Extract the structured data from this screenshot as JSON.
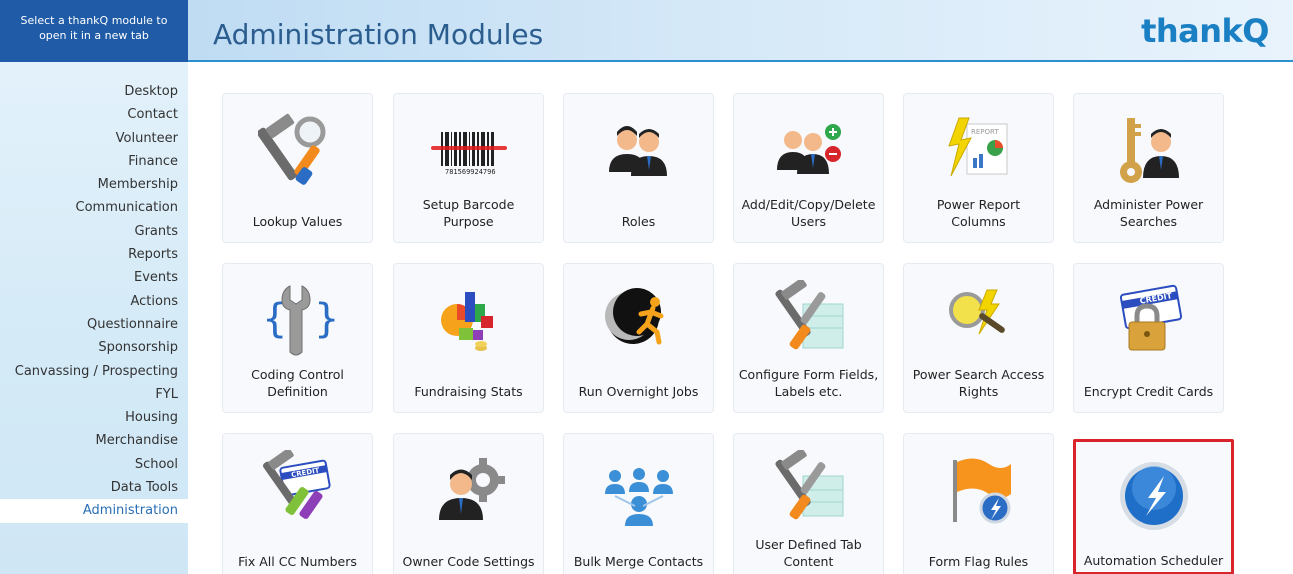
{
  "sidebar": {
    "header": "Select a thankQ module to open it in a new tab",
    "items": [
      {
        "label": "Desktop"
      },
      {
        "label": "Contact"
      },
      {
        "label": "Volunteer"
      },
      {
        "label": "Finance"
      },
      {
        "label": "Membership"
      },
      {
        "label": "Communication"
      },
      {
        "label": "Grants"
      },
      {
        "label": "Reports"
      },
      {
        "label": "Events"
      },
      {
        "label": "Actions"
      },
      {
        "label": "Questionnaire"
      },
      {
        "label": "Sponsorship"
      },
      {
        "label": "Canvassing / Prospecting"
      },
      {
        "label": "FYL"
      },
      {
        "label": "Housing"
      },
      {
        "label": "Merchandise"
      },
      {
        "label": "School"
      },
      {
        "label": "Data Tools"
      },
      {
        "label": "Administration",
        "active": true
      }
    ]
  },
  "header": {
    "title": "Administration Modules",
    "logo": "thankQ"
  },
  "modules": [
    {
      "label": "Lookup Values",
      "icon": "hammer-screwdriver-magnifier-icon"
    },
    {
      "label": "Setup Barcode Purpose",
      "icon": "barcode-icon",
      "barcode_text": "781569924796"
    },
    {
      "label": "Roles",
      "icon": "people-icon"
    },
    {
      "label": "Add/Edit/Copy/Delete Users",
      "icon": "users-add-remove-icon"
    },
    {
      "label": "Power Report Columns",
      "icon": "power-report-icon",
      "report_text": "REPORT"
    },
    {
      "label": "Administer Power Searches",
      "icon": "key-user-icon"
    },
    {
      "label": "Coding Control Definition",
      "icon": "wrench-braces-icon"
    },
    {
      "label": "Fundraising Stats",
      "icon": "chart-cubes-icon"
    },
    {
      "label": "Run Overnight Jobs",
      "icon": "moon-runner-icon"
    },
    {
      "label": "Configure Form Fields, Labels etc.",
      "icon": "tools-form-icon"
    },
    {
      "label": "Power Search Access Rights",
      "icon": "search-key-icon"
    },
    {
      "label": "Encrypt Credit Cards",
      "icon": "credit-card-lock-icon",
      "card_text": "CREDIT"
    },
    {
      "label": "Fix All CC Numbers",
      "icon": "credit-card-tools-icon",
      "card_text": "CREDIT"
    },
    {
      "label": "Owner Code Settings",
      "icon": "user-gear-icon"
    },
    {
      "label": "Bulk Merge Contacts",
      "icon": "merge-people-icon"
    },
    {
      "label": "User Defined Tab Content",
      "icon": "tools-tab-icon"
    },
    {
      "label": "Form Flag Rules",
      "icon": "flag-scheduler-icon"
    },
    {
      "label": "Automation Scheduler",
      "icon": "lightning-orb-icon",
      "highlighted": true
    }
  ],
  "colors": {
    "sidebar_header": "#1f5ba6",
    "title": "#2b5d8e",
    "logo": "#1a7fc3",
    "active_item": "#2a6fb5",
    "highlight_border": "#d8242a"
  }
}
